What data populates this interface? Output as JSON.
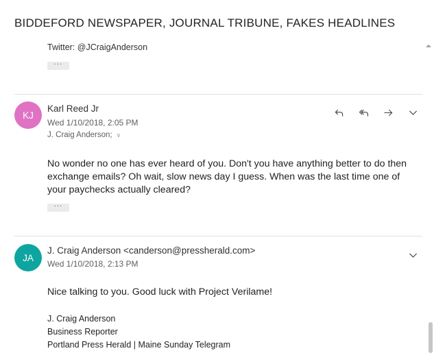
{
  "thread": {
    "title": "BIDDEFORD NEWSPAPER, JOURNAL TRIBUNE, FAKES HEADLINES"
  },
  "partial_message": {
    "twitter_line": "Twitter: @JCraigAnderson",
    "more_label": "···"
  },
  "messages": [
    {
      "initials": "KJ",
      "avatar_color": "#e072c4",
      "sender": "Karl Reed Jr",
      "date": "Wed 1/10/2018, 2:05 PM",
      "to": "J. Craig Anderson;",
      "body": "No wonder no one has ever heard of you. Don't you have anything better to do then exchange emails? Oh wait, slow news day I guess. When was the last time one of your paychecks actually cleared?",
      "more_label": "···"
    },
    {
      "initials": "JA",
      "avatar_color": "#0ea5a0",
      "sender": "J. Craig Anderson <canderson@pressherald.com>",
      "date": "Wed 1/10/2018, 2:13 PM",
      "body": "Nice talking to you. Good luck with Project Verilame!",
      "signature": [
        "J. Craig Anderson",
        "Business Reporter",
        "Portland Press Herald | Maine Sunday Telegram"
      ]
    }
  ],
  "icons": {
    "reply": "reply-icon",
    "reply_all": "reply-all-icon",
    "forward": "forward-icon",
    "more": "chevron-down-icon"
  }
}
